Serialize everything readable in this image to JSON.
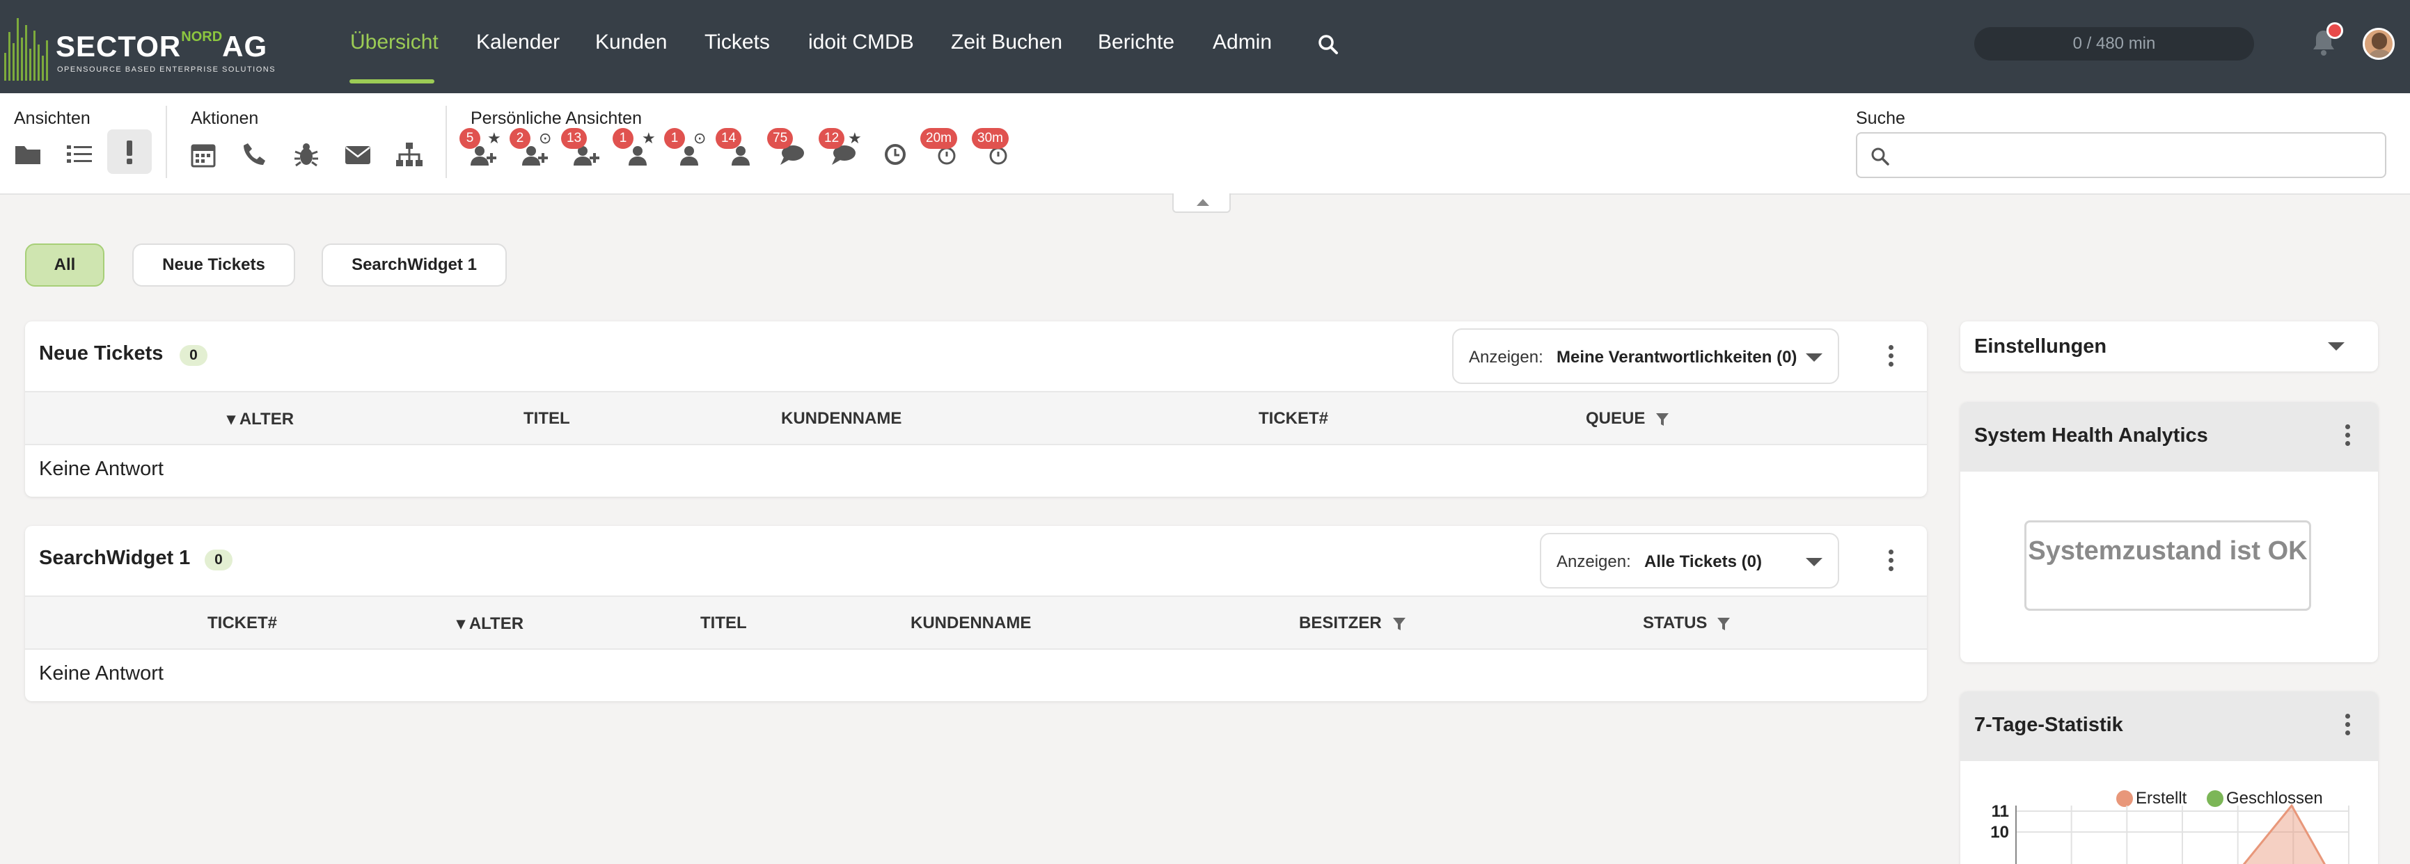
{
  "brand": {
    "name": "SECTOR",
    "sup": "NORD",
    "suffix": "AG",
    "tagline": "OPENSOURCE BASED ENTERPRISE SOLUTIONS"
  },
  "nav": {
    "items": [
      {
        "label": "Übersicht",
        "active": true
      },
      {
        "label": "Kalender"
      },
      {
        "label": "Kunden"
      },
      {
        "label": "Tickets"
      },
      {
        "label": "idoit CMDB"
      },
      {
        "label": "Zeit Buchen"
      },
      {
        "label": "Berichte"
      },
      {
        "label": "Admin"
      }
    ],
    "search_icon": "search-icon",
    "time_tracker": "0 / 480 min",
    "accent": "#9ccc55",
    "background": "#373f47"
  },
  "toolbar": {
    "views_label": "Ansichten",
    "actions_label": "Aktionen",
    "personal_label": "Persönliche Ansichten",
    "search_label": "Suche",
    "search_placeholder": "",
    "views_icons": [
      "folder-icon",
      "list-icon",
      "exclamation-icon"
    ],
    "actions_icons": [
      "calendar-icon",
      "phone-icon",
      "bug-icon",
      "envelope-icon",
      "sitemap-icon"
    ],
    "personal_badges": [
      "5",
      "2",
      "13",
      "1",
      "1",
      "14",
      "75",
      "12",
      "20m",
      "30m"
    ],
    "badge_color": "#e0524f"
  },
  "filters": [
    {
      "label": "All",
      "active": true
    },
    {
      "label": "Neue Tickets"
    },
    {
      "label": "SearchWidget 1"
    }
  ],
  "widgets": {
    "new_tickets": {
      "title": "Neue Tickets",
      "count": "0",
      "show_label": "Anzeigen:",
      "show_value": "Meine Verantwortlichkeiten (0)",
      "columns": [
        "▾ ALTER",
        "TITEL",
        "KUNDENNAME",
        "TICKET#",
        "QUEUE"
      ],
      "empty": "Keine Antwort"
    },
    "search_widget": {
      "title": "SearchWidget 1",
      "count": "0",
      "show_label": "Anzeigen:",
      "show_value": "Alle Tickets (0)",
      "columns": [
        "TICKET#",
        "▾ ALTER",
        "TITEL",
        "KUNDENNAME",
        "BESITZER",
        "STATUS"
      ],
      "empty": "Keine Antwort"
    }
  },
  "sidebar": {
    "settings_title": "Einstellungen",
    "health_title": "System Health Analytics",
    "health_status": "Systemzustand ist OK",
    "stats_title": "7-Tage-Statistik"
  },
  "chart_data": {
    "type": "area",
    "series": [
      {
        "name": "Erstellt",
        "color": "#e8977a"
      },
      {
        "name": "Geschlossen",
        "color": "#7cb657"
      }
    ],
    "y_ticks": [
      "11",
      "10"
    ],
    "ylim": [
      0,
      11
    ]
  }
}
